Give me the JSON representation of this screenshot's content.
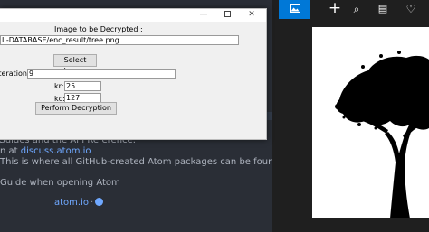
{
  "atom": {
    "line1": "Guides and the API Reference.",
    "line2_prefix": "n at ",
    "line2_link": "discuss.atom.io",
    "line3": "This is where all GitHub-created Atom packages can be found.",
    "line4": "Guide when opening Atom",
    "footer_link": "atom.io",
    "footer_sep": "·"
  },
  "dialog": {
    "image_label": "Image to be Decrypted :",
    "path_value": "I -DATABASE/enc_result/tree.png",
    "select_button": "Select Image",
    "iterations_label": "Iterations:",
    "iterations_value": "9",
    "kr_label": "kr:",
    "kr_value": "25",
    "kc_label": "kc:",
    "kc_value": "127",
    "decrypt_button": "Perform Decryption",
    "minimize_glyph": "—",
    "close_glyph": "✕"
  },
  "viewer": {
    "icons": [
      "picture-icon",
      "plus-icon",
      "zoom-icon",
      "trash-icon",
      "heart-icon"
    ],
    "plus_glyph": "+",
    "zoom_glyph": "⌕",
    "trash_glyph": "▤",
    "heart_glyph": "♡",
    "accent": "#0078d7"
  }
}
